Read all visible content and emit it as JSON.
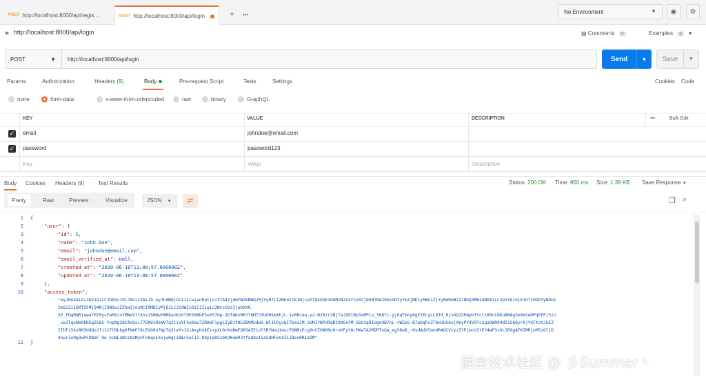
{
  "tabs": [
    {
      "method": "POST",
      "label": "http://localhost:8000/api/regis..."
    },
    {
      "method": "POST",
      "label": "http://localhost:8000/api/login",
      "active": true
    }
  ],
  "tab_actions": {
    "add": "+",
    "more": "•••"
  },
  "environment": {
    "label": "No Environment"
  },
  "request": {
    "title": "http://localhost:8000/api/login",
    "comments_label": "Comments",
    "comments_count": "0",
    "examples_label": "Examples",
    "examples_count": "0",
    "method": "POST",
    "url": "http://localhost:8000/api/login",
    "send_label": "Send",
    "save_label": "Save"
  },
  "request_tabs": {
    "params": "Params",
    "authorization": "Authorization",
    "headers": "Headers",
    "headers_count": "(9)",
    "body": "Body",
    "prerequest": "Pre-request Script",
    "tests": "Tests",
    "settings": "Settings",
    "cookies": "Cookies",
    "code": "Code"
  },
  "body_types": [
    "none",
    "form-data",
    "x-www-form-urlencoded",
    "raw",
    "binary",
    "GraphQL"
  ],
  "params_table": {
    "headers": {
      "key": "KEY",
      "value": "VALUE",
      "description": "DESCRIPTION",
      "more": "•••",
      "bulk_edit": "Bulk Edit"
    },
    "rows": [
      {
        "key": "email",
        "value": "johndoe@email.com"
      },
      {
        "key": "password",
        "value": "password123"
      }
    ],
    "placeholder": {
      "key": "Key",
      "value": "Value",
      "description": "Description"
    }
  },
  "response": {
    "tabs": {
      "body": "Body",
      "cookies": "Cookies",
      "headers": "Headers",
      "headers_count": "(9)",
      "tests": "Test Results"
    },
    "status_label": "Status:",
    "status": "200 OK",
    "time_label": "Time:",
    "time": "950 ms",
    "size_label": "Size:",
    "size": "1.39 KB",
    "save_response": "Save Response",
    "views": [
      "Pretty",
      "Raw",
      "Preview",
      "Visualize"
    ],
    "format": "JSON",
    "line_numbers": [
      "1",
      "2",
      "3",
      "4",
      "5",
      "6",
      "7",
      "8",
      "9",
      "10",
      "11"
    ],
    "json": {
      "user_key": "\"user\"",
      "id_key": "\"id\"",
      "id_val": "5",
      "name_key": "\"name\"",
      "name_val": "\"John Doe\"",
      "email_key": "\"email\"",
      "email_val": "\"johndoe@email.com\"",
      "verified_key": "\"email_verified_at\"",
      "verified_val": "null",
      "created_key": "\"created_at\"",
      "created_val": "\"2020-06-18T13:08:57.000000Z\"",
      "updated_key": "\"updated_at\"",
      "updated_val": "\"2020-06-18T13:08:57.000000Z\"",
      "token_key": "\"access_token\"",
      "token_lines": [
        "\"eyJ0eXAiOiJKV1QiLCJhbGciOiJSUzI1NiJ9.eyJhdWQiOiIzIiwianRpIjoiYTA4ZjdmYWZkNWQzMjYyNTllZWE4Yzk1NjcwYTQ4OGE3OGMzNzU4YzU3ZjQ5NTNmZGExODYyYmZjNDIyMmU1ZjYyNmRmN2ZlNGQ3MWI4NDAiLCJpYXQiOjE1OTI0ODYyNDUs",
        "ImSiZi16MTU5MjQ4NjI0NSwiZXhwIjoxNjI0MDIyMjQ1LCJzdWIiOiI1Iiwic2NvcGVzIjpbXX0.",
        "XV_FQqRNRjawa7H70ysFwMXzvYMNaV1tXns1SH8wYWR8avKzOlOE59NbESuXS7Up-2bfADxBRJTbM7JYUGRkmmhjL-1v0Hcee-y2-NJ0zr2BjTaJXE1Bp3sMPiu_S68fc-gjOqTmoy6gE2ELyLLOfd_6jx4Q2XEmpbfYcti6BcLBKu8MAg3oXW1eDPqEEFi5iz",
        "_ux2TqxWeRkbEgZG85-tnpNg28IAcQsi77ENVo9sWVTq2iixVFkxKau7ZRA6FipgiZyBitH5ZBVMSdwO-WC1lDyxQITbsxJM_SGMIYNPURqBtO0GnFM_GbUzgRIUgnUB7nL-vWZp5-B7aOqPcZTAxGHSbsjXbyPYdV9TcSqsDWR94dIsSbQyrkjYXFtotJOEZ",
        "IIhFi5kvBM3UdQoJfi11FCNL6g6fN4Ff6LEUG0n7WpTq3ieYx1XiAxyHxkEixyXL0cKoBmFQ8S4ZEiolSRYNoq1euzfONMzEcg9uVZUN00n6rxKFyYA-MXwTA2RDPTnGa_egSDw8_-0sdAdXlmnOR4GCVzyzZYFimcVItEY4wFSvhL3EOgAfKIMRjoMSzOljD",
        "4nwrZoOg3wP59BaF_Ue_kcWLnNczAaMyUToAqu1Xxjw0giiBmrEal13-RXp1qRSsbK3Num9JYfa8Ox15aS8HFwV4ZLJBevRR10ZM\""
      ]
    }
  },
  "watermark": "掘金技术社区 @ 彡Summer丶"
}
